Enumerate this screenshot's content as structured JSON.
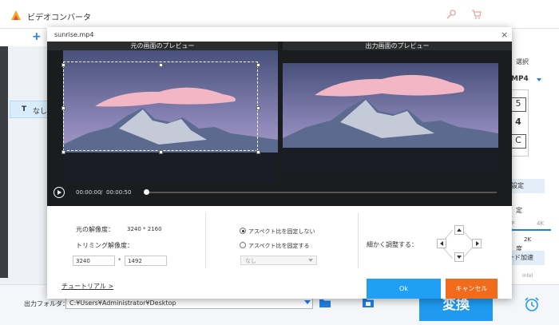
{
  "app": {
    "title": "ビデオコンバータ",
    "add_label": "+",
    "subtitle_item": {
      "icon": "T",
      "label": "なし"
    },
    "right_panel": {
      "format_heading": "選択",
      "format_value": "MP4",
      "preview_digit_a": "5",
      "preview_digit_b": "4",
      "preview_digit_c": "C",
      "settings_label": "設定",
      "quality_heading": "定",
      "res_low": "P",
      "res_high": "4K",
      "res_mid": "2K",
      "quality_heading2": "度",
      "gpu_label": "ード加速",
      "intel_label": "Intel"
    },
    "bottom": {
      "output_folder_label": "出力フォルダ：",
      "output_path": "C:¥Users¥Administrator¥Desktop",
      "convert_label": "変換"
    },
    "colors": {
      "accent": "#1f9af0",
      "cancel": "#f26a1b"
    }
  },
  "dialog": {
    "title": "sunrise.mp4",
    "close_glyph": "×",
    "original_preview_label": "元の画面のプレビュー",
    "output_preview_label": "出力画面のプレビュー",
    "time_current": "00:00:00",
    "time_separator": "/",
    "time_total": "00:00:50",
    "progress": 0,
    "original_resolution_label": "元の解像度：",
    "original_resolution_value": "3240 * 2160",
    "trim_resolution_label": "トリミング解像度：",
    "trim_width": "3240",
    "trim_times": "*",
    "trim_height": "1492",
    "aspect_unlocked_label": "アスペクト比を固定しない",
    "aspect_locked_label": "アスペクト比を固定する",
    "aspect_select_value": "なし",
    "fine_adjust_label": "細かく調整する：",
    "tutorial_link": "チュートリアル >",
    "ok_label": "Ok",
    "cancel_label": "キャンセル"
  }
}
